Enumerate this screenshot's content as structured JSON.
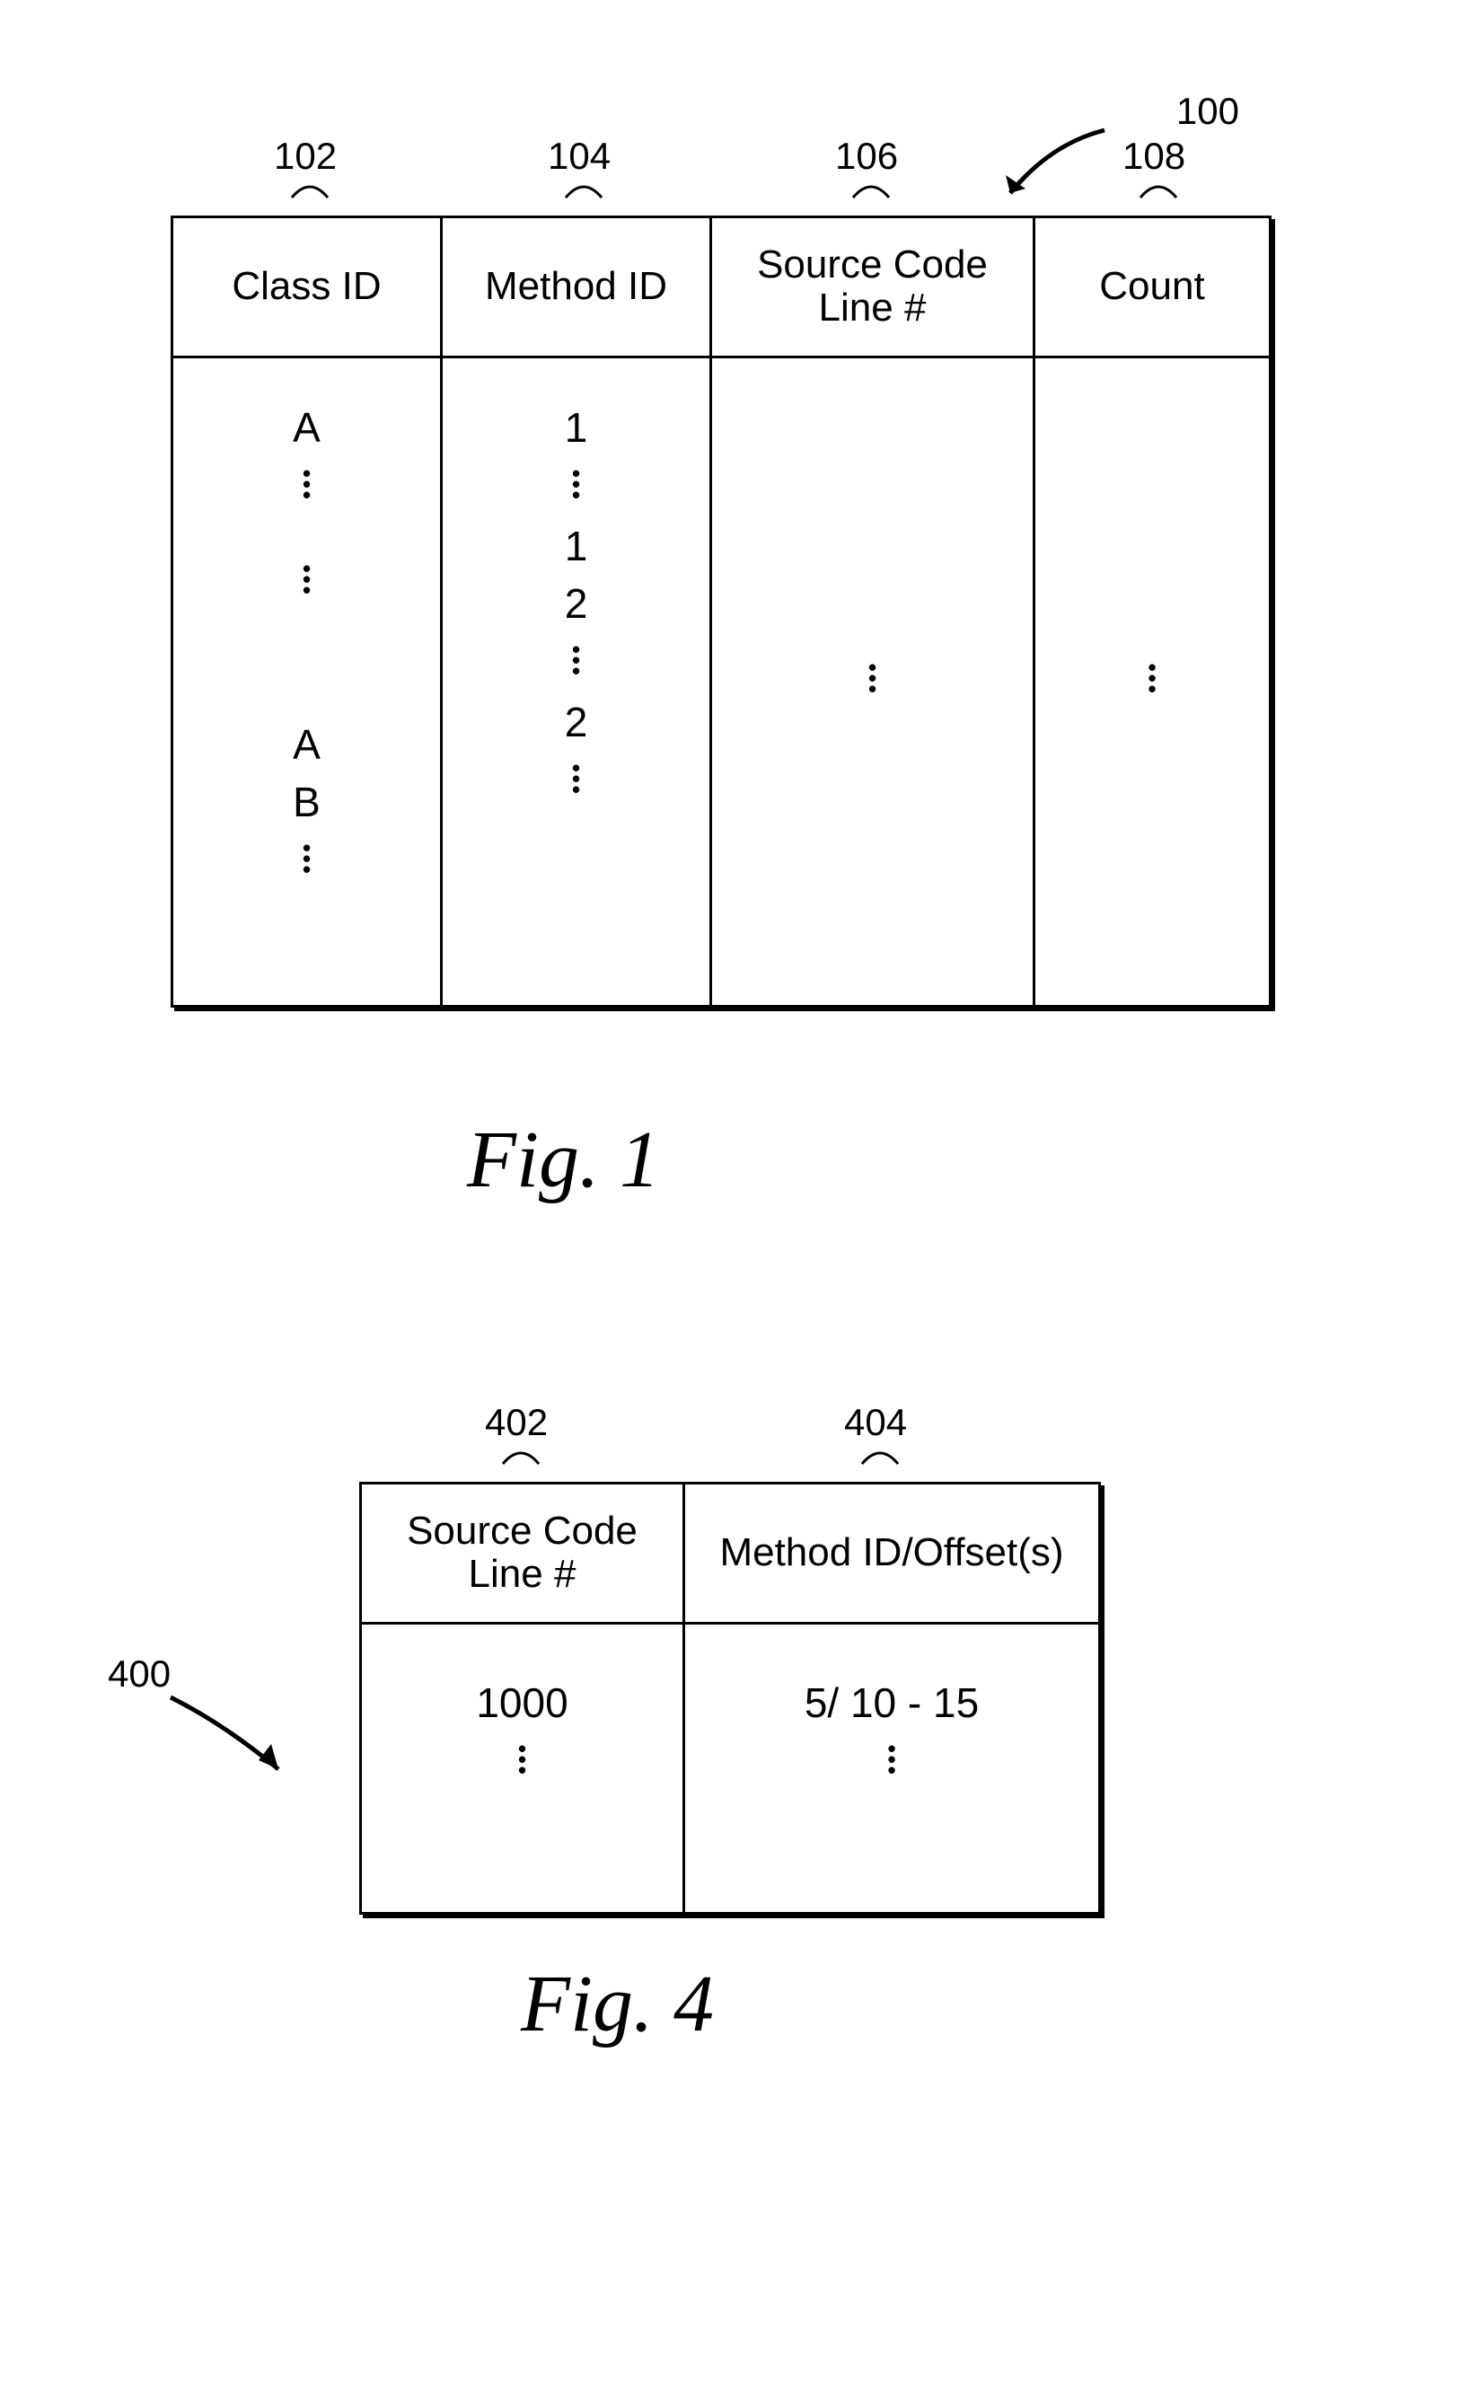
{
  "fig1": {
    "ref_main": "100",
    "col_refs": [
      "102",
      "104",
      "106",
      "108"
    ],
    "headers": [
      "Class ID",
      "Method ID",
      "Source Code\nLine #",
      "Count"
    ],
    "body": {
      "class_col": [
        "A",
        "⋮",
        "A",
        "B",
        "⋮"
      ],
      "method_col": [
        "1",
        "⋮",
        "1",
        "2",
        "⋮",
        "2",
        "⋮"
      ],
      "source_col": [
        "⋮"
      ],
      "count_col": [
        "⋮"
      ]
    },
    "caption": "Fig.  1"
  },
  "fig4": {
    "ref_main": "400",
    "col_refs": [
      "402",
      "404"
    ],
    "headers": [
      "Source Code\nLine #",
      "Method ID/Offset(s)"
    ],
    "body": {
      "line_col": [
        "1000",
        "⋮"
      ],
      "method_col": [
        "5/ 10 - 15",
        "⋮"
      ]
    },
    "caption": "Fig.  4"
  }
}
